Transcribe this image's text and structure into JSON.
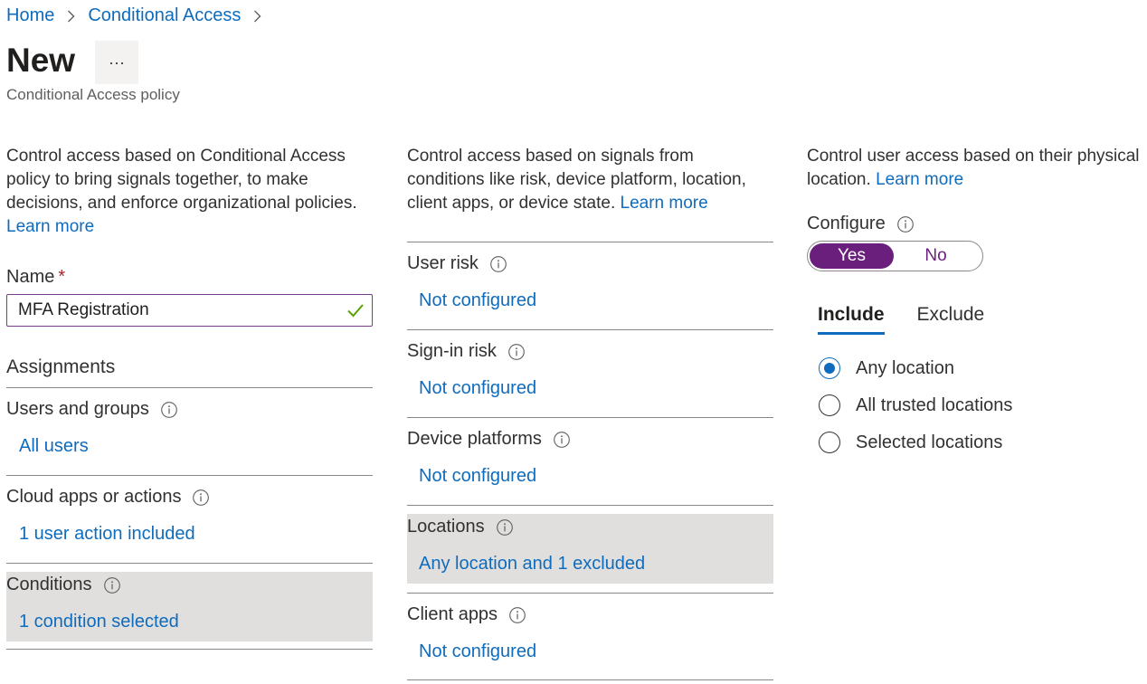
{
  "breadcrumb": {
    "home": "Home",
    "section": "Conditional Access"
  },
  "header": {
    "title": "New",
    "more": "···",
    "subtitle": "Conditional Access policy"
  },
  "column1": {
    "description": "Control access based on Conditional Access policy to bring signals together, to make decisions, and enforce organizational policies.",
    "learn_more": "Learn more",
    "name_label": "Name",
    "required_mark": "*",
    "name_value": "MFA Registration",
    "assignments_heading": "Assignments",
    "items": [
      {
        "title": "Users and groups",
        "value": "All users"
      },
      {
        "title": "Cloud apps or actions",
        "value": "1 user action included"
      },
      {
        "title": "Conditions",
        "value": "1 condition selected"
      }
    ]
  },
  "column2": {
    "description": "Control access based on signals from conditions like risk, device platform, location, client apps, or device state.",
    "learn_more": "Learn more",
    "items": [
      {
        "title": "User risk",
        "value": "Not configured"
      },
      {
        "title": "Sign-in risk",
        "value": "Not configured"
      },
      {
        "title": "Device platforms",
        "value": "Not configured"
      },
      {
        "title": "Locations",
        "value": "Any location and 1 excluded"
      },
      {
        "title": "Client apps",
        "value": "Not configured"
      }
    ]
  },
  "column3": {
    "description": "Control user access based on their physical location.",
    "learn_more": "Learn more",
    "configure_label": "Configure",
    "toggle": {
      "yes": "Yes",
      "no": "No",
      "selected": "Yes"
    },
    "tabs": [
      {
        "label": "Include"
      },
      {
        "label": "Exclude"
      }
    ],
    "active_tab": "Include",
    "radios": [
      {
        "label": "Any location"
      },
      {
        "label": "All trusted locations"
      },
      {
        "label": "Selected locations"
      }
    ],
    "selected_radio": "Any location"
  },
  "colors": {
    "link": "#0f6cbd",
    "toggle_on": "#6b1f7c",
    "highlight": "#e1dfdd",
    "required": "#a4262c",
    "valid_check": "#57a300"
  }
}
